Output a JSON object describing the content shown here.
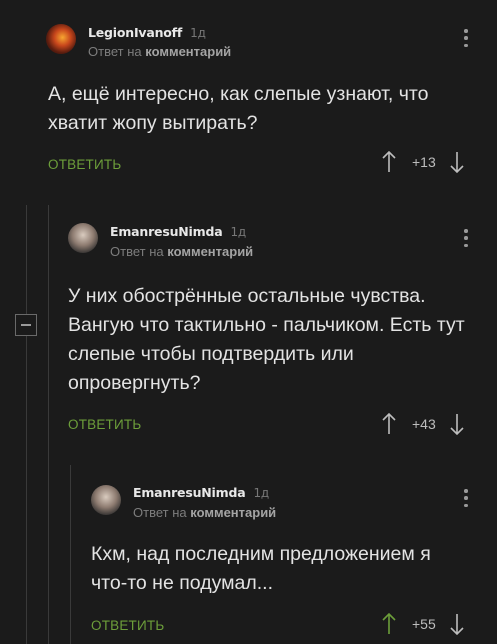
{
  "comments": [
    {
      "author": "LegionIvanoff",
      "age": "1д",
      "reply_prefix": "Ответ на",
      "reply_target": "комментарий",
      "text": "А, ещё интересно, как слепые узнают, что хватит жопу вытирать?",
      "reply_label": "ОТВЕТИТЬ",
      "score": "+13",
      "avatar": "fire-avatar"
    },
    {
      "author": "EmanresuNimda",
      "age": "1д",
      "reply_prefix": "Ответ на",
      "reply_target": "комментарий",
      "text": "У них обострённые остальные чувства. Вангую что тактильно - пальчиком. Есть тут слепые чтобы подтвердить или опровергнуть?",
      "reply_label": "ОТВЕТИТЬ",
      "score": "+43",
      "avatar": "person-avatar"
    },
    {
      "author": "EmanresuNimda",
      "age": "1д",
      "reply_prefix": "Ответ на",
      "reply_target": "комментарий",
      "text": "Кхм, над последним предложением я что-то не подумал...",
      "reply_label": "ОТВЕТИТЬ",
      "score": "+55",
      "avatar": "person-avatar"
    }
  ],
  "colors": {
    "background": "#1b1b1b",
    "reply_accent": "#6c9e3a",
    "thread_line": "#3a3a3a"
  }
}
